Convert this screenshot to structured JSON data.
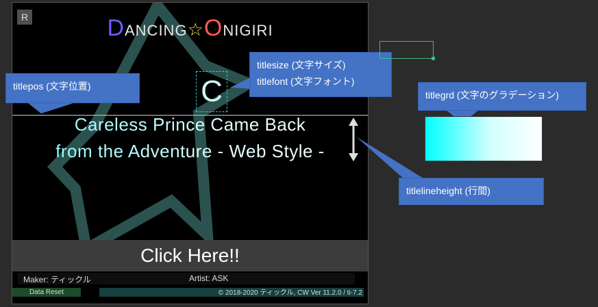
{
  "game": {
    "r_button": "R",
    "logo": {
      "d": "D",
      "ancing": "ANCING",
      "star": "☆",
      "o": "O",
      "nigiri": "NIGIRI"
    },
    "title_letter": "C",
    "title_line1": "Careless Prince Came Back",
    "title_line2": "from the Adventure - Web Style -",
    "click_label": "Click Here!!",
    "maker": "Maker: ティックル",
    "artist": "Artist: ASK",
    "data_reset": "Data Reset",
    "version": "© 2018-2020 ティックル, CW Ver 11.2.0 / ti-7.2"
  },
  "annotations": {
    "titlepos": "titlepos (文字位置)",
    "titlesize": "titlesize (文字サイズ)",
    "titlefont": "titlefont (文字フォント)",
    "titlegrd": "titlegrd (文字のグラデーション)",
    "titlelineheight": "titlelineheight (行間)"
  },
  "colors": {
    "logo_d": "#6a5cff",
    "logo_o": "#ff5a5a",
    "callout_bg": "#4472c4",
    "title_gradient_start": "#00ffff",
    "title_gradient_end": "#ffffff"
  }
}
